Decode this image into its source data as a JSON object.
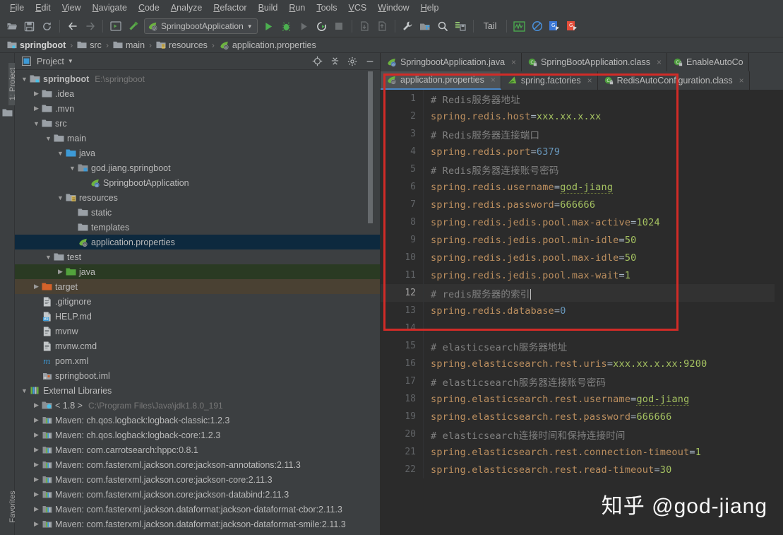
{
  "menubar": {
    "items": [
      "File",
      "Edit",
      "View",
      "Navigate",
      "Code",
      "Analyze",
      "Refactor",
      "Build",
      "Run",
      "Tools",
      "VCS",
      "Window",
      "Help"
    ]
  },
  "toolbar": {
    "icons": [
      "open-folder-icon",
      "save-all-icon",
      "sync-icon",
      "back-arrow-icon",
      "forward-arrow-icon",
      "run-console-icon",
      "build-hammer-icon"
    ],
    "run_config": "SpringbootApplication",
    "run_icons": [
      "run-icon",
      "debug-icon",
      "run-with-coverage-icon",
      "rerun-icon",
      "stop-icon"
    ],
    "right_icons": [
      "update-project-icon",
      "commit-icon",
      "settings-wrench-icon",
      "project-structure-icon",
      "search-icon",
      "save-db-icon"
    ],
    "tail_label": "Tail",
    "trailing_icons": [
      "monitor-icon",
      "no-entry-icon",
      "google-blue-icon",
      "google-red-icon"
    ]
  },
  "navbar": {
    "crumbs": [
      "springboot",
      "src",
      "main",
      "resources",
      "application.properties"
    ]
  },
  "toolstrip": {
    "project_label": "1: Project",
    "favorites_label": "Favorites"
  },
  "project_panel": {
    "title": "Project",
    "header_icons": [
      "locate-icon",
      "collapse-all-icon",
      "gear-icon",
      "minimize-icon"
    ],
    "tree": [
      {
        "indent": 0,
        "arrow": "down",
        "icon": "module-icon",
        "label": "springboot",
        "bold": true,
        "sub": "E:\\springboot",
        "state": "none"
      },
      {
        "indent": 1,
        "arrow": "right",
        "icon": "folder-icon",
        "label": ".idea",
        "state": "none"
      },
      {
        "indent": 1,
        "arrow": "right",
        "icon": "folder-icon",
        "label": ".mvn",
        "state": "none"
      },
      {
        "indent": 1,
        "arrow": "down",
        "icon": "folder-icon",
        "label": "src",
        "state": "none"
      },
      {
        "indent": 2,
        "arrow": "down",
        "icon": "folder-icon",
        "label": "main",
        "state": "none"
      },
      {
        "indent": 3,
        "arrow": "down",
        "icon": "source-folder-icon",
        "label": "java",
        "state": "none"
      },
      {
        "indent": 4,
        "arrow": "down",
        "icon": "package-icon",
        "label": "god.jiang.springboot",
        "state": "none"
      },
      {
        "indent": 5,
        "arrow": "none",
        "icon": "spring-class-icon",
        "label": "SpringbootApplication",
        "state": "none"
      },
      {
        "indent": 3,
        "arrow": "down",
        "icon": "resource-folder-icon",
        "label": "resources",
        "state": "none"
      },
      {
        "indent": 4,
        "arrow": "none",
        "icon": "folder-icon",
        "label": "static",
        "state": "none"
      },
      {
        "indent": 4,
        "arrow": "none",
        "icon": "folder-icon",
        "label": "templates",
        "state": "none"
      },
      {
        "indent": 4,
        "arrow": "none",
        "icon": "spring-file-icon",
        "label": "application.properties",
        "state": "selected"
      },
      {
        "indent": 2,
        "arrow": "down",
        "icon": "folder-icon",
        "label": "test",
        "state": "none"
      },
      {
        "indent": 3,
        "arrow": "right",
        "icon": "test-folder-icon",
        "label": "java",
        "state": "green"
      },
      {
        "indent": 1,
        "arrow": "right",
        "icon": "target-folder-icon",
        "label": "target",
        "state": "brown"
      },
      {
        "indent": 1,
        "arrow": "none",
        "icon": "file-icon",
        "label": ".gitignore",
        "state": "none"
      },
      {
        "indent": 1,
        "arrow": "none",
        "icon": "markdown-icon",
        "label": "HELP.md",
        "state": "none"
      },
      {
        "indent": 1,
        "arrow": "none",
        "icon": "file-icon",
        "label": "mvnw",
        "state": "none"
      },
      {
        "indent": 1,
        "arrow": "none",
        "icon": "file-icon",
        "label": "mvnw.cmd",
        "state": "none"
      },
      {
        "indent": 1,
        "arrow": "none",
        "icon": "maven-icon",
        "label": "pom.xml",
        "state": "none"
      },
      {
        "indent": 1,
        "arrow": "none",
        "icon": "iml-icon",
        "label": "springboot.iml",
        "state": "none"
      },
      {
        "indent": 0,
        "arrow": "down",
        "icon": "libraries-icon",
        "label": "External Libraries",
        "state": "none"
      },
      {
        "indent": 1,
        "arrow": "right",
        "icon": "jdk-icon",
        "label": "< 1.8 >",
        "sub": "C:\\Program Files\\Java\\jdk1.8.0_191",
        "state": "none"
      },
      {
        "indent": 1,
        "arrow": "right",
        "icon": "library-icon",
        "label": "Maven: ch.qos.logback:logback-classic:1.2.3",
        "state": "none"
      },
      {
        "indent": 1,
        "arrow": "right",
        "icon": "library-icon",
        "label": "Maven: ch.qos.logback:logback-core:1.2.3",
        "state": "none"
      },
      {
        "indent": 1,
        "arrow": "right",
        "icon": "library-icon",
        "label": "Maven: com.carrotsearch:hppc:0.8.1",
        "state": "none"
      },
      {
        "indent": 1,
        "arrow": "right",
        "icon": "library-icon",
        "label": "Maven: com.fasterxml.jackson.core:jackson-annotations:2.11.3",
        "state": "none"
      },
      {
        "indent": 1,
        "arrow": "right",
        "icon": "library-icon",
        "label": "Maven: com.fasterxml.jackson.core:jackson-core:2.11.3",
        "state": "none"
      },
      {
        "indent": 1,
        "arrow": "right",
        "icon": "library-icon",
        "label": "Maven: com.fasterxml.jackson.core:jackson-databind:2.11.3",
        "state": "none"
      },
      {
        "indent": 1,
        "arrow": "right",
        "icon": "library-icon",
        "label": "Maven: com.fasterxml.jackson.dataformat:jackson-dataformat-cbor:2.11.3",
        "state": "none"
      },
      {
        "indent": 1,
        "arrow": "right",
        "icon": "library-icon",
        "label": "Maven: com.fasterxml.jackson.dataformat:jackson-dataformat-smile:2.11.3",
        "state": "none"
      }
    ]
  },
  "editor": {
    "tabs_row1": [
      {
        "label": "SpringbootApplication.java",
        "icon": "spring-class-icon",
        "closable": true,
        "active": false
      },
      {
        "label": "SpringBootApplication.class",
        "icon": "class-lock-icon",
        "closable": true,
        "active": false
      },
      {
        "label": "EnableAutoCo",
        "icon": "class-lock-icon",
        "closable": false,
        "active": false
      }
    ],
    "tabs_row2": [
      {
        "label": "application.properties",
        "icon": "spring-file-icon",
        "closable": true,
        "active": true
      },
      {
        "label": "spring.factories",
        "icon": "properties-icon",
        "closable": true,
        "active": false
      },
      {
        "label": "RedisAutoConfiguration.class",
        "icon": "class-lock-icon",
        "closable": true,
        "active": false
      }
    ],
    "lines": [
      {
        "n": 1,
        "type": "comment",
        "text": "# Redis服务器地址"
      },
      {
        "n": 2,
        "type": "prop",
        "key": "spring.redis.host",
        "value": "xxx.xx.x.xx",
        "vtype": "str"
      },
      {
        "n": 3,
        "type": "comment",
        "text": "# Redis服务器连接端口"
      },
      {
        "n": 4,
        "type": "prop",
        "key": "spring.redis.port",
        "value": "6379",
        "vtype": "num"
      },
      {
        "n": 5,
        "type": "comment",
        "text": "# Redis服务器连接账号密码"
      },
      {
        "n": 6,
        "type": "prop",
        "key": "spring.redis.username",
        "value": "god-jiang",
        "vtype": "typo"
      },
      {
        "n": 7,
        "type": "prop",
        "key": "spring.redis.password",
        "value": "666666",
        "vtype": "str"
      },
      {
        "n": 8,
        "type": "prop",
        "key": "spring.redis.jedis.pool.max-active",
        "value": "1024",
        "vtype": "str"
      },
      {
        "n": 9,
        "type": "prop",
        "key": "spring.redis.jedis.pool.min-idle",
        "value": "50",
        "vtype": "str"
      },
      {
        "n": 10,
        "type": "prop",
        "key": "spring.redis.jedis.pool.max-idle",
        "value": "50",
        "vtype": "str"
      },
      {
        "n": 11,
        "type": "prop",
        "key": "spring.redis.jedis.pool.max-wait",
        "value": "1",
        "vtype": "str"
      },
      {
        "n": 12,
        "type": "comment",
        "text": "# redis服务器的索引",
        "current": true,
        "caret": true
      },
      {
        "n": 13,
        "type": "prop",
        "key": "spring.redis.database",
        "value": "0",
        "vtype": "num"
      },
      {
        "n": 14,
        "type": "blank",
        "text": ""
      },
      {
        "n": 15,
        "type": "comment",
        "text": "# elasticsearch服务器地址"
      },
      {
        "n": 16,
        "type": "prop",
        "key": "spring.elasticsearch.rest.uris",
        "value": "xxx.xx.x.xx:9200",
        "vtype": "str"
      },
      {
        "n": 17,
        "type": "comment",
        "text": "# elasticsearch服务器连接账号密码"
      },
      {
        "n": 18,
        "type": "prop",
        "key": "spring.elasticsearch.rest.username",
        "value": "god-jiang",
        "vtype": "typo"
      },
      {
        "n": 19,
        "type": "prop",
        "key": "spring.elasticsearch.rest.password",
        "value": "666666",
        "vtype": "str"
      },
      {
        "n": 20,
        "type": "comment",
        "text": "# elasticsearch连接时间和保持连接时间"
      },
      {
        "n": 21,
        "type": "prop",
        "key": "spring.elasticsearch.rest.connection-timeout",
        "value": "1",
        "vtype": "str"
      },
      {
        "n": 22,
        "type": "prop",
        "key": "spring.elasticsearch.rest.read-timeout",
        "value": "30",
        "vtype": "str"
      }
    ]
  },
  "annotation": {
    "redbox_color": "#d22b27"
  },
  "watermark": {
    "text": "知乎 @god-jiang"
  },
  "colors": {
    "bg_editor": "#2b2b2b",
    "bg_chrome": "#3c3f41",
    "accent_tab": "#4a88c7",
    "key": "#bc8f5f",
    "value": "#a5c261",
    "number": "#6897bb",
    "comment": "#808080"
  }
}
